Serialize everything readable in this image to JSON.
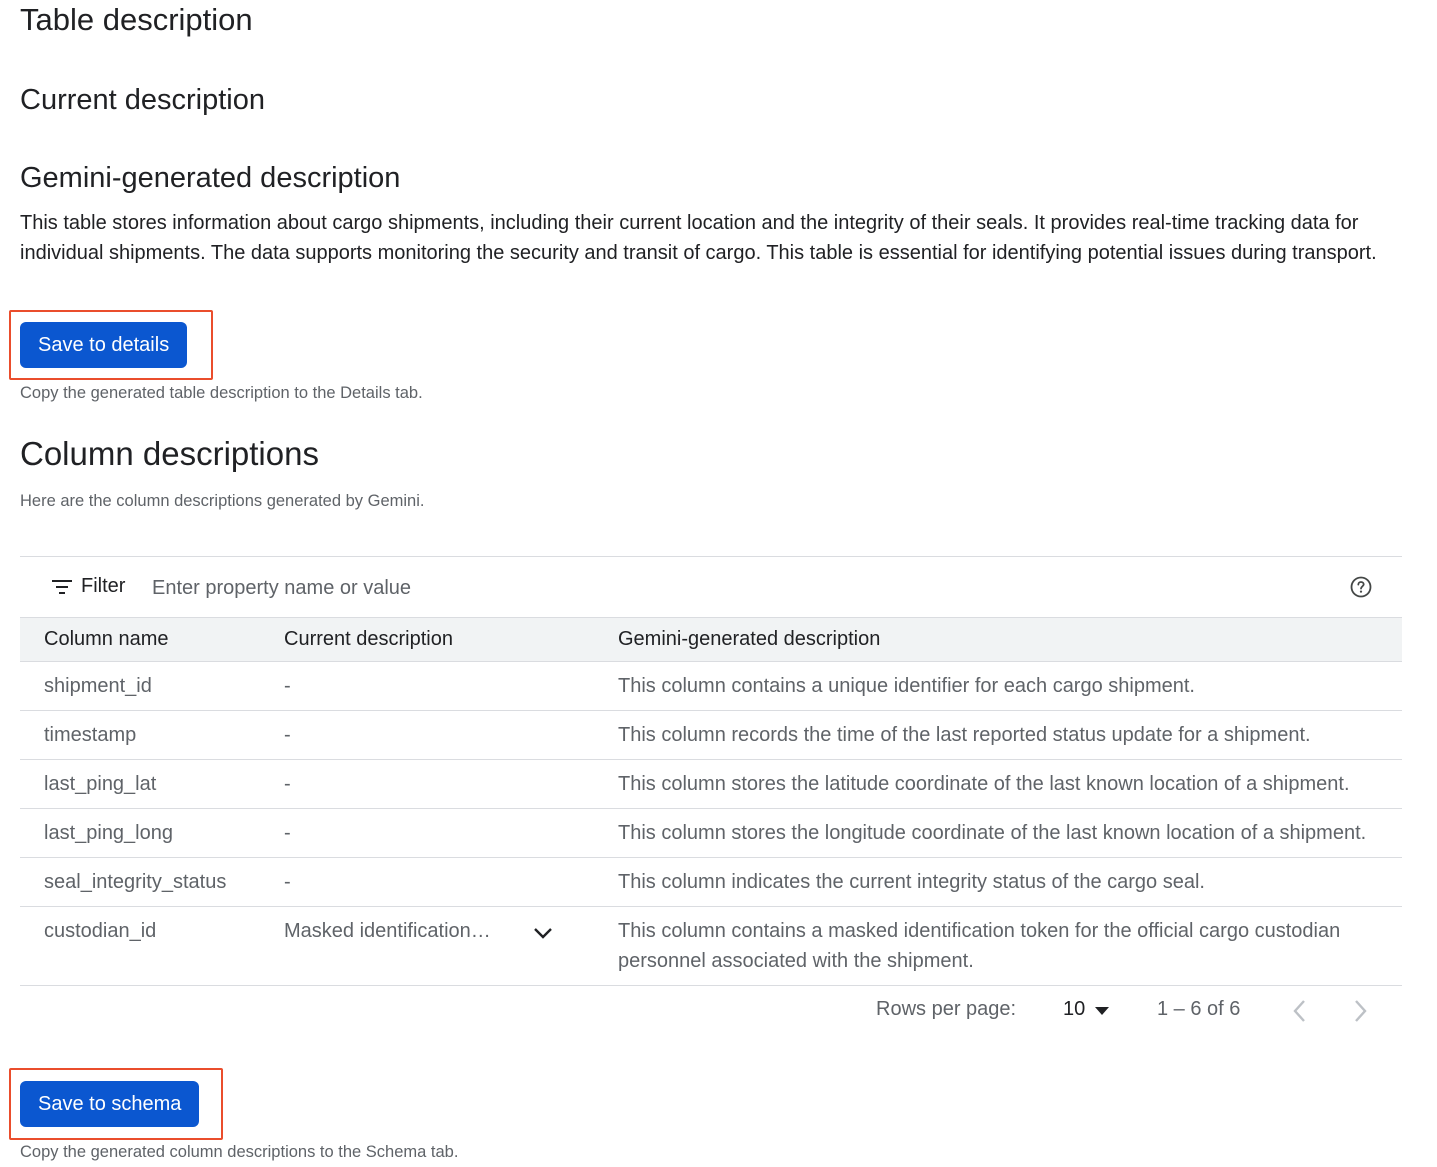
{
  "headings": {
    "table_description": "Table description",
    "current_description": "Current description",
    "gemini_generated": "Gemini-generated description",
    "column_descriptions": "Column descriptions"
  },
  "generated_table_description": "This table stores information about cargo shipments, including their current location and the integrity of their seals. It provides real-time tracking data for individual shipments. The data supports monitoring the security and transit of cargo. This table is essential for identifying potential issues during transport.",
  "save_details": {
    "label": "Save to details",
    "hint": "Copy the generated table description to the Details tab."
  },
  "column_intro": "Here are the column descriptions generated by Gemini.",
  "filter": {
    "label": "Filter",
    "placeholder": "Enter property name or value"
  },
  "table": {
    "headers": [
      "Column name",
      "Current description",
      "Gemini-generated description"
    ],
    "rows": [
      {
        "name": "shipment_id",
        "current": "-",
        "generated": "This column contains a unique identifier for each cargo shipment."
      },
      {
        "name": "timestamp",
        "current": "-",
        "generated": "This column records the time of the last reported status update for a shipment."
      },
      {
        "name": "last_ping_lat",
        "current": "-",
        "generated": "This column stores the latitude coordinate of the last known location of a shipment."
      },
      {
        "name": "last_ping_long",
        "current": "-",
        "generated": "This column stores the longitude coordinate of the last known location of a shipment."
      },
      {
        "name": "seal_integrity_status",
        "current": "-",
        "generated": "This column indicates the current integrity status of the cargo seal."
      },
      {
        "name": "custodian_id",
        "current": "Masked identification…",
        "generated": "This column contains a masked identification token for the official cargo custodian personnel associated with the shipment."
      }
    ]
  },
  "pager": {
    "rows_per_page_label": "Rows per page:",
    "rows_per_page_value": "10",
    "range": "1 – 6 of 6"
  },
  "save_schema": {
    "label": "Save to schema",
    "hint": "Copy the generated column descriptions to the Schema tab."
  },
  "colors": {
    "primary": "#0b57d0",
    "highlight": "#ea4d2c",
    "header_bg": "#f1f3f4",
    "border": "#dadce0"
  }
}
